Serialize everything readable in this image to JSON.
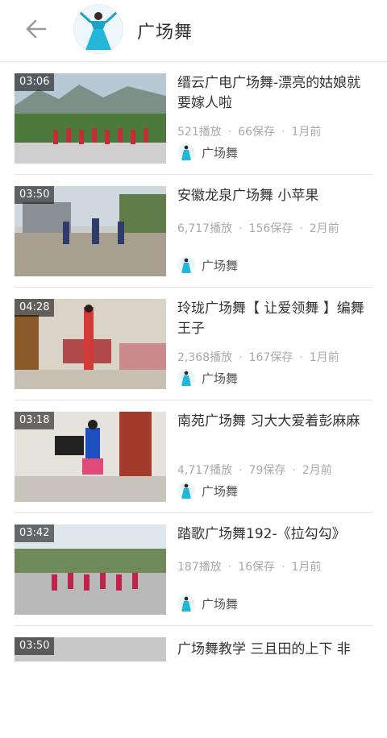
{
  "header": {
    "title": "广场舞",
    "back_icon": "arrow-left-icon"
  },
  "videos": [
    {
      "duration": "03:06",
      "title": "缙云广电广场舞-漂亮的姑娘就要嫁人啦",
      "plays": "521播放",
      "saves": "66保存",
      "time": "1月前",
      "uploader": "广场舞"
    },
    {
      "duration": "03:50",
      "title": "安徽龙泉广场舞 小苹果",
      "plays": "6,717播放",
      "saves": "156保存",
      "time": "2月前",
      "uploader": "广场舞"
    },
    {
      "duration": "04:28",
      "title": "玲珑广场舞【 让爱领舞 】编舞王子",
      "plays": "2,368播放",
      "saves": "167保存",
      "time": "1月前",
      "uploader": "广场舞"
    },
    {
      "duration": "03:18",
      "title": "南苑广场舞 习大大爱着彭麻麻",
      "plays": "4,717播放",
      "saves": "79保存",
      "time": "2月前",
      "uploader": "广场舞"
    },
    {
      "duration": "03:42",
      "title": "踏歌广场舞192-《拉勾勾》",
      "plays": "187播放",
      "saves": "16保存",
      "time": "1月前",
      "uploader": "广场舞"
    }
  ],
  "partial": {
    "duration": "03:50",
    "title": "广场舞教学 三且田的上下 非"
  }
}
